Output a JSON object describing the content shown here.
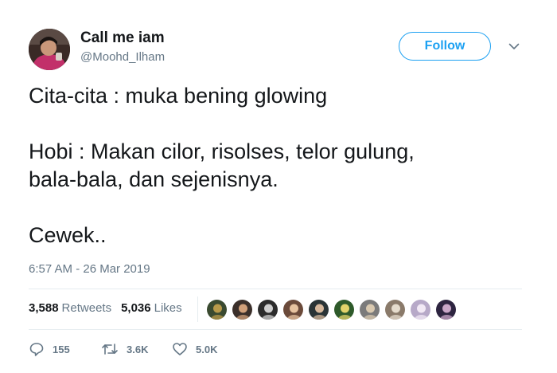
{
  "author": {
    "display_name": "Call me iam",
    "handle": "@Moohd_Ilham"
  },
  "follow_button": {
    "label": "Follow"
  },
  "tweet": {
    "lines": [
      "Cita-cita : muka bening glowing",
      "Hobi : Makan cilor, risolses, telor gulung,",
      "bala-bala, dan sejenisnya.",
      "Cewek.."
    ],
    "timestamp": "6:57 AM - 26 Mar 2019"
  },
  "stats": {
    "retweets_count": "3,588",
    "retweets_label": "Retweets",
    "likes_count": "5,036",
    "likes_label": "Likes"
  },
  "likers": [
    {
      "bg": "#3a4a30",
      "fg": "#b89a4a"
    },
    {
      "bg": "#3b2f2a",
      "fg": "#d1a07a"
    },
    {
      "bg": "#2c2c2c",
      "fg": "#cfcfcf"
    },
    {
      "bg": "#6b4a3a",
      "fg": "#e7c3a0"
    },
    {
      "bg": "#2a3436",
      "fg": "#d6b89c"
    },
    {
      "bg": "#2e5a2a",
      "fg": "#e2d36a"
    },
    {
      "bg": "#7b7b7b",
      "fg": "#d9c9b0"
    },
    {
      "bg": "#8a7a6a",
      "fg": "#e6dccd"
    },
    {
      "bg": "#b7a9c8",
      "fg": "#f2e9f5"
    },
    {
      "bg": "#2d2440",
      "fg": "#c9a6c8"
    }
  ],
  "actions": {
    "replies": "155",
    "retweets": "3.6K",
    "likes": "5.0K"
  },
  "colors": {
    "accent": "#1da1f2",
    "secondary_text": "#657786",
    "divider": "#e6ecf0"
  },
  "icons": [
    "chevron-down-icon",
    "reply-icon",
    "retweet-icon",
    "heart-icon"
  ]
}
